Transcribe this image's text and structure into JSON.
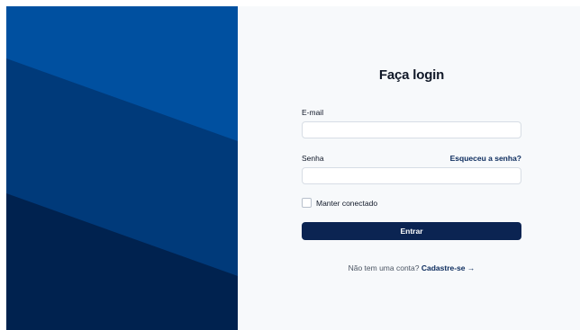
{
  "login": {
    "title": "Faça login",
    "email_label": "E-mail",
    "email_value": "",
    "password_label": "Senha",
    "password_value": "",
    "forgot_password": "Esqueceu a senha?",
    "remember_label": "Manter conectado",
    "remember_checked": false,
    "submit_label": "Entrar",
    "signup_prompt": "Não tem uma conta?",
    "signup_link": "Cadastre-se",
    "signup_arrow": "→"
  },
  "colors": {
    "panel_top": "#0050a0",
    "panel_middle": "#003a7a",
    "panel_bottom": "#00224f",
    "button": "#0b2452",
    "background": "#f7f9fb"
  }
}
